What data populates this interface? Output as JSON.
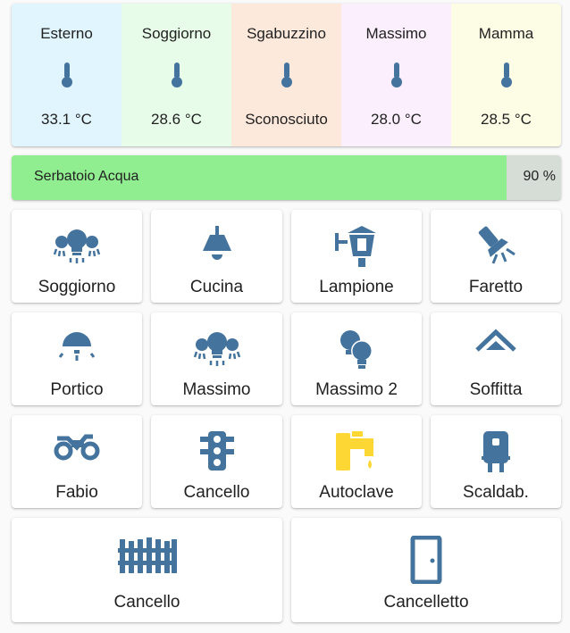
{
  "temperatures": [
    {
      "name": "Esterno",
      "value": "33.1 °C",
      "bg": "#e1f5fe"
    },
    {
      "name": "Soggiorno",
      "value": "28.6 °C",
      "bg": "#e8fde9"
    },
    {
      "name": "Sgabuzzino",
      "value": "Sconosciuto",
      "bg": "#fde9dc"
    },
    {
      "name": "Massimo",
      "value": "28.0 °C",
      "bg": "#fbeffd"
    },
    {
      "name": "Mamma",
      "value": "28.5 °C",
      "bg": "#fcfde4"
    }
  ],
  "tank": {
    "label": "Serbatoio Acqua",
    "percent_text": "90 %",
    "level": 0.9,
    "fill_color": "#90ee90"
  },
  "buttons": [
    {
      "label": "Soggiorno",
      "icon": "ceiling-lights-icon"
    },
    {
      "label": "Cucina",
      "icon": "ceiling-lamp-icon"
    },
    {
      "label": "Lampione",
      "icon": "outdoor-lamp-icon"
    },
    {
      "label": "Faretto",
      "icon": "spotlight-icon"
    },
    {
      "label": "Portico",
      "icon": "porch-light-icon"
    },
    {
      "label": "Massimo",
      "icon": "ceiling-lights-icon"
    },
    {
      "label": "Massimo 2",
      "icon": "bulbs-icon"
    },
    {
      "label": "Soffitta",
      "icon": "attic-icon"
    },
    {
      "label": "Fabio",
      "icon": "bicycle-icon"
    },
    {
      "label": "Cancello",
      "icon": "traffic-light-icon"
    },
    {
      "label": "Autoclave",
      "icon": "water-pump-icon"
    },
    {
      "label": "Scaldab.",
      "icon": "water-heater-icon"
    }
  ],
  "big_buttons": [
    {
      "label": "Cancello",
      "icon": "gate-icon"
    },
    {
      "label": "Cancelletto",
      "icon": "door-icon"
    }
  ],
  "colors": {
    "icon": "#44739e",
    "icon_active": "#fdd835",
    "text": "#212121"
  }
}
